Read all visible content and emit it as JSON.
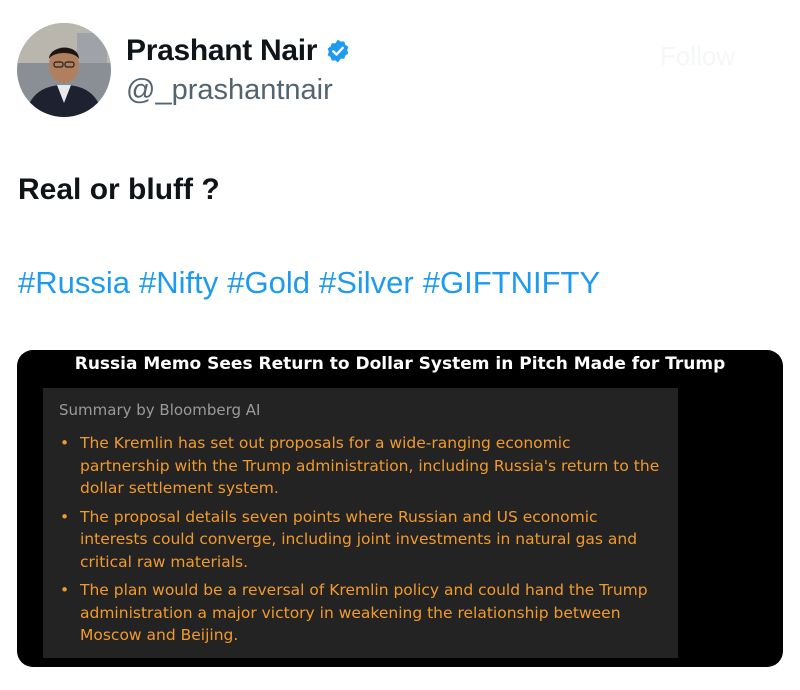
{
  "author": {
    "name": "Prashant Nair",
    "handle": "@_prashantnair",
    "verified": true,
    "avatar_icon": "profile-photo",
    "verified_icon": "verified-badge-icon",
    "follow_label": "Follow"
  },
  "tweet": {
    "text": "Real or bluff ?",
    "hashtags": [
      "#Russia",
      "#Nifty",
      "#Gold",
      "#Silver",
      "#GIFTNIFTY"
    ]
  },
  "media": {
    "headline": "Russia Memo Sees Return to Dollar System in Pitch Made for Trump",
    "summary_heading": "Summary by Bloomberg AI",
    "bullets": [
      "The Kremlin has set out proposals for a wide-ranging economic partnership with the Trump administration, including Russia's return to the dollar settlement system.",
      "The proposal details seven points where Russian and US economic interests could converge, including joint investments in natural gas and critical raw materials.",
      "The plan would be a reversal of Kremlin policy and could hand the Trump administration a major victory in weakening the relationship between Moscow and Beijing."
    ]
  },
  "colors": {
    "link": "#1d9bf0",
    "verified": "#1d9bf0",
    "bullet_text": "#f19a2e",
    "media_bg": "#000000",
    "summary_bg": "#232323"
  }
}
